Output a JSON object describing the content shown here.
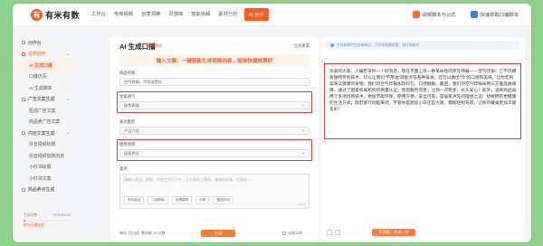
{
  "brand": {
    "name": "有米有数",
    "logo_char": "有"
  },
  "nav": {
    "items": [
      "工作台",
      "电商视频",
      "创意洞察",
      "灵感库",
      "智能拆解",
      "素材分析",
      "AI 创作"
    ],
    "links": [
      "视频脚本与公式",
      "快速抓取口播脚本"
    ]
  },
  "sidebar": {
    "items": [
      {
        "label": "创作台",
        "type": "sec"
      },
      {
        "label": "视频创作",
        "type": "sec open"
      },
      {
        "label": "AI 生成口播",
        "type": "sub active"
      },
      {
        "label": "口播仿写",
        "type": "sub"
      },
      {
        "label": "AI 生成脚本",
        "type": "sub"
      },
      {
        "label": "广告文案生成",
        "type": "sec"
      },
      {
        "label": "短视广告文案",
        "type": "sub"
      },
      {
        "label": "商品卖广告文案",
        "type": "sub"
      },
      {
        "label": "内容文案生成",
        "type": "sec"
      },
      {
        "label": "抖音视频标题",
        "type": "sub"
      },
      {
        "label": "抖音视频加购内容",
        "type": "sub"
      },
      {
        "label": "小红书标题",
        "type": "sub"
      },
      {
        "label": "小红书文案",
        "type": "sub"
      },
      {
        "label": "商品卖点生成",
        "type": "sec"
      }
    ],
    "quota": {
      "label": "生成次数",
      "value": "1378/40000",
      "used_fraction": 0.034,
      "link": "前往开通权限"
    }
  },
  "form": {
    "title": "AI 生成口播",
    "tag": "使用教程",
    "reset": "全部重置",
    "banner": "输入文案，一键智能生成视频内容，简单快捷效果好",
    "product_label": "商品名称",
    "product_value": "空气炸锅，不用油烹饪",
    "tone_label": "文案语气",
    "tone_value": "理性客观",
    "length_label": "表达类型",
    "length_value": "产品介绍",
    "scene_label": "使用场景",
    "scene_value": "居家烹饪",
    "desc_label": "卖点",
    "desc_placeholder": "请输入卖点，例如：你好工作日下午，让在家吃上健康、美味的早餐，在家吃...",
    "keywords": [
      "专利保证",
      "口感酥脆",
      "品牌保障",
      "包邮",
      "赠品好用"
    ],
    "counter": "0/500",
    "footer_note": "单次【生成】需消耗 10 点数",
    "generate": "生成",
    "sample": "勾选示例"
  },
  "output": {
    "note": "生成结果中包含敏感词，已为你隐藏处理，请仔细核对",
    "text": "亲爱的大家，小编告诉你一个好消息，现在市面上有一种革命性的烹饪神器——空气炸锅！它不仅拥有独特专利技术，可以让我们“不用油”就能烹饪各种美食，还可以做出“炸”的口感和美味。让你吃到美味又健康的食物，我们的空气炸锅加热均匀，口感酥脆。最后，我们的空气炸锅采用三方面品质保障，通过了国家权威机构的质量认证，售后服务完善，让你一次购买，长久安心！此外，该款商品采用了多项创新技术，更加节能环保，使用方便，安全可靠，是居家烹饪的理想之选！想要拥有更健康的生活方式，就赶紧行动起来吧，不管你是厨房小白还是大厨，都能轻松驾驭，让你的餐桌更加丰富多彩！",
    "continue": "不满意，再试一次"
  },
  "colors": {
    "accent": "#ff5a1f",
    "highlight": "#e53935"
  }
}
